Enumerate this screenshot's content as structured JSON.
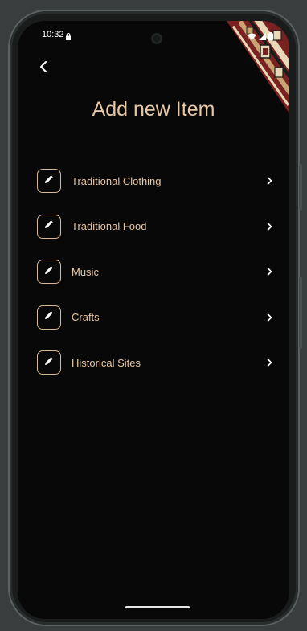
{
  "status_bar": {
    "time": "10:32"
  },
  "header": {
    "title": "Add new Item",
    "back_icon": "chevron-left-icon"
  },
  "items": [
    {
      "label": "Traditional Clothing",
      "icon": "pencil-icon"
    },
    {
      "label": "Traditional Food",
      "icon": "pencil-icon"
    },
    {
      "label": "Music",
      "icon": "pencil-icon"
    },
    {
      "label": "Crafts",
      "icon": "pencil-icon"
    },
    {
      "label": "Historical Sites",
      "icon": "pencil-icon"
    }
  ],
  "colors": {
    "accent": "#e6c7a3",
    "background": "#080808",
    "border": "#d8b896"
  }
}
